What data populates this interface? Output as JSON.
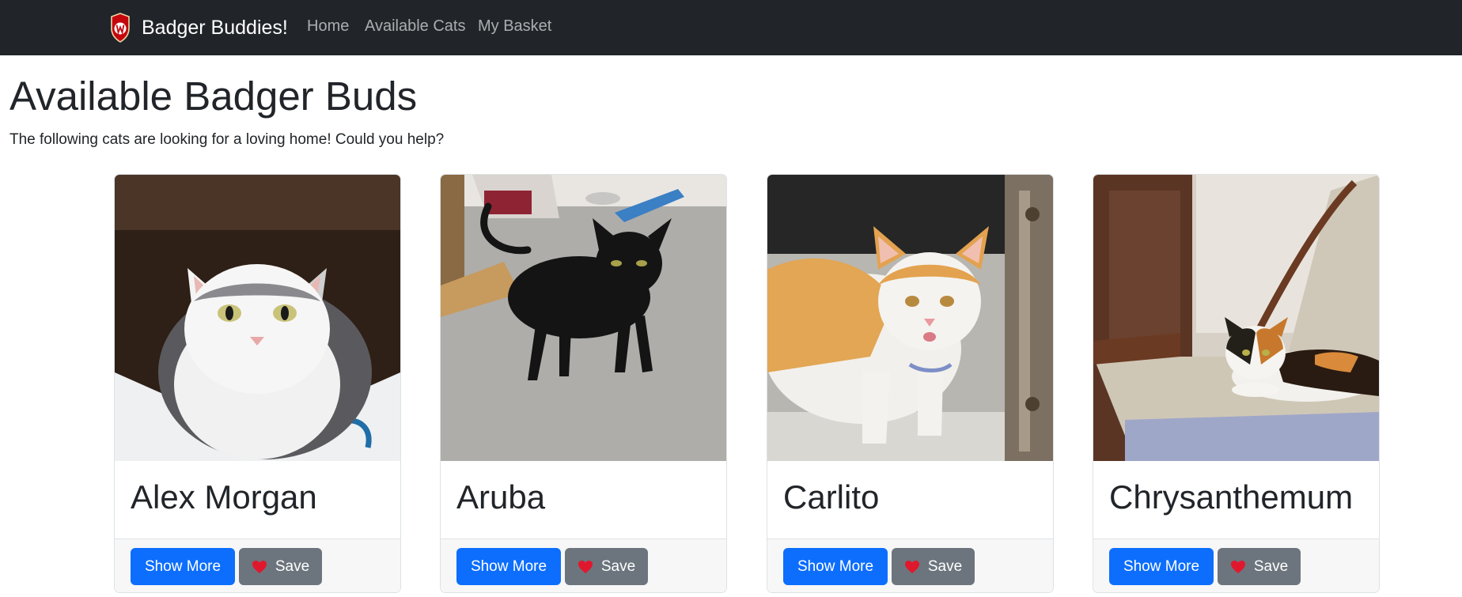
{
  "navbar": {
    "brand": "Badger Buddies!",
    "links": [
      {
        "label": "Home"
      },
      {
        "label": "Available Cats"
      },
      {
        "label": "My Basket"
      }
    ]
  },
  "page": {
    "title": "Available Badger Buds",
    "subtitle": "The following cats are looking for a loving home! Could you help?"
  },
  "cats": [
    {
      "name": "Alex Morgan",
      "more_label": "Show More",
      "save_label": "Save"
    },
    {
      "name": "Aruba",
      "more_label": "Show More",
      "save_label": "Save"
    },
    {
      "name": "Carlito",
      "more_label": "Show More",
      "save_label": "Save"
    },
    {
      "name": "Chrysanthemum",
      "more_label": "Show More",
      "save_label": "Save"
    }
  ],
  "icons": {
    "logo": "uw-crest-icon",
    "save": "heart-icon",
    "photos": [
      "cat-photo-icon",
      "cat-photo-icon",
      "cat-photo-icon",
      "cat-photo-icon"
    ]
  },
  "colors": {
    "navbar_bg": "#212529",
    "primary_button": "#0d6efd",
    "secondary_button": "#6c757d",
    "heart": "#e0182d",
    "crest": "#c5050c"
  }
}
